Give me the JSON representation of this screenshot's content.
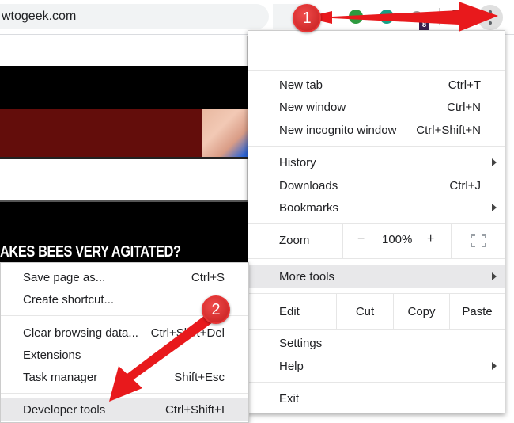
{
  "toolbar": {
    "url": "wtogeek.com",
    "extension_badge": "8",
    "menu_icon": "kebab-menu-icon"
  },
  "page": {
    "headline": "AKES BEES VERY AGITATED?"
  },
  "menu": {
    "items": [
      {
        "label": "New tab",
        "shortcut": "Ctrl+T"
      },
      {
        "label": "New window",
        "shortcut": "Ctrl+N"
      },
      {
        "label": "New incognito window",
        "shortcut": "Ctrl+Shift+N"
      },
      {
        "label": "History",
        "submenu": true
      },
      {
        "label": "Downloads",
        "shortcut": "Ctrl+J"
      },
      {
        "label": "Bookmarks",
        "submenu": true
      }
    ],
    "zoom": {
      "label": "Zoom",
      "minus": "−",
      "value": "100%",
      "plus": "+",
      "fullscreen_icon": "fullscreen-icon"
    },
    "more_tools": {
      "label": "More tools",
      "submenu": true
    },
    "edit": {
      "label": "Edit",
      "cut": "Cut",
      "copy": "Copy",
      "paste": "Paste"
    },
    "settings": {
      "label": "Settings"
    },
    "help": {
      "label": "Help",
      "submenu": true
    },
    "exit": {
      "label": "Exit"
    }
  },
  "submenu": {
    "items": [
      {
        "label": "Save page as...",
        "shortcut": "Ctrl+S"
      },
      {
        "label": "Create shortcut..."
      },
      {
        "label": "Clear browsing data...",
        "shortcut": "Ctrl+Shift+Del"
      },
      {
        "label": "Extensions"
      },
      {
        "label": "Task manager",
        "shortcut": "Shift+Esc"
      },
      {
        "label": "Developer tools",
        "shortcut": "Ctrl+Shift+I"
      }
    ]
  },
  "annotations": {
    "step1": "1",
    "step2": "2",
    "color": "#e8191c"
  }
}
